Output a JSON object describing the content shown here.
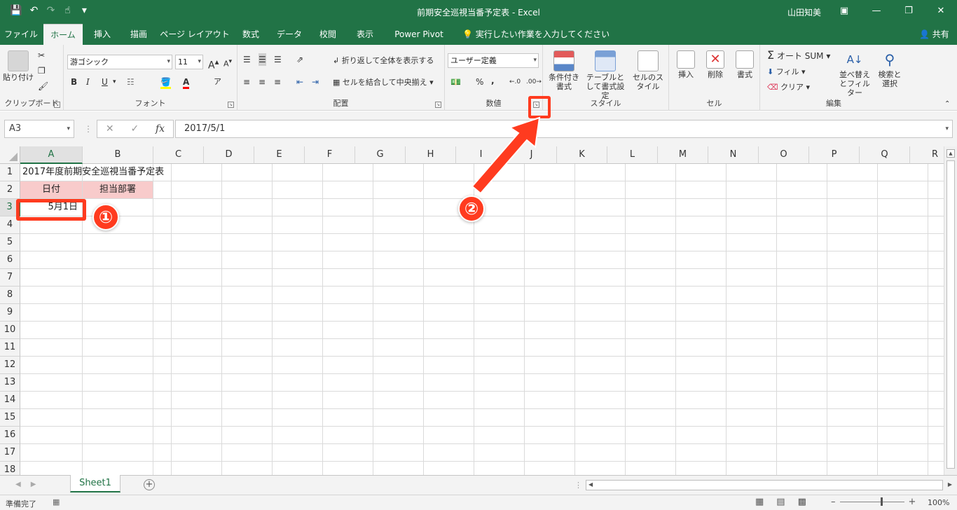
{
  "window": {
    "title": "前期安全巡視当番予定表 - Excel",
    "user": "山田知美",
    "qat_icons": [
      "save-icon",
      "undo-icon",
      "redo-icon",
      "touch-mode-icon",
      "customize-qat-icon"
    ],
    "controls": [
      "ribbon-display-icon",
      "minimize-icon",
      "restore-icon",
      "close-icon"
    ]
  },
  "tabs": [
    "ファイル",
    "ホーム",
    "挿入",
    "描画",
    "ページ レイアウト",
    "数式",
    "データ",
    "校閲",
    "表示",
    "Power Pivot"
  ],
  "tellme": "実行したい作業を入力してください",
  "share": "共有",
  "ribbon": {
    "clipboard": {
      "label": "クリップボード",
      "paste": "貼り付け"
    },
    "font": {
      "label": "フォント",
      "name": "游ゴシック",
      "size": "11",
      "bold": "B",
      "italic": "I",
      "underline": "U",
      "grow": "A",
      "shrink": "A",
      "color": "A"
    },
    "alignment": {
      "label": "配置",
      "wrap": "折り返して全体を表示する",
      "merge": "セルを結合して中央揃え"
    },
    "number": {
      "label": "数値",
      "format": "ユーザー定義",
      "percent": "%",
      "comma": ","
    },
    "styles": {
      "label": "スタイル",
      "conditional": "条件付き書式",
      "table": "テーブルとして書式設定",
      "cell": "セルのスタイル"
    },
    "cells": {
      "label": "セル",
      "insert": "挿入",
      "delete": "削除",
      "format": "書式"
    },
    "editing": {
      "label": "編集",
      "autosum": "オート SUM",
      "fill": "フィル",
      "clear": "クリア",
      "sort": "並べ替えとフィルター",
      "find": "検索と選択"
    }
  },
  "formula_bar": {
    "name_box": "A3",
    "value": "2017/5/1",
    "fx": "fx"
  },
  "columns": [
    "A",
    "B",
    "C",
    "D",
    "E",
    "F",
    "G",
    "H",
    "I",
    "J",
    "K",
    "L",
    "M",
    "N",
    "O",
    "P",
    "Q",
    "R"
  ],
  "rows": [
    "1",
    "2",
    "3",
    "4",
    "5",
    "6",
    "7",
    "8",
    "9",
    "10",
    "11",
    "12",
    "13",
    "14",
    "15",
    "16",
    "17",
    "18"
  ],
  "cells": {
    "a1": "2017年度前期安全巡視当番予定表",
    "a2": "日付",
    "b2": "担当部署",
    "a3": "5月1日"
  },
  "sheet_tab": "Sheet1",
  "status": {
    "ready": "準備完了",
    "zoom": "100%"
  },
  "annotations": {
    "mark1": "①",
    "mark2": "②"
  },
  "colors": {
    "accent": "#217346",
    "header_fill": "#f8cbcb",
    "annotation": "#ff3b1f"
  }
}
